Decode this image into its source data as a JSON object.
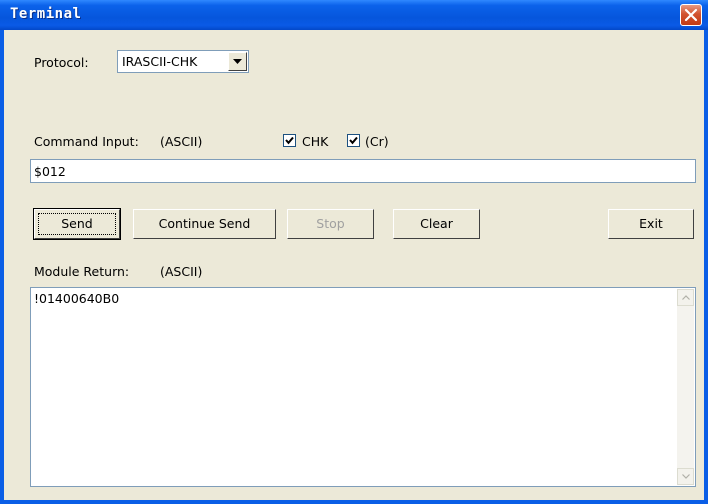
{
  "window": {
    "title": "Terminal"
  },
  "protocol": {
    "label": "Protocol:",
    "value": "IRASCII-CHK"
  },
  "command": {
    "label": "Command Input:",
    "mode": "(ASCII)",
    "chk_label": "CHK",
    "chk_checked": true,
    "cr_label": "(Cr)",
    "cr_checked": true,
    "value": "$012"
  },
  "buttons": {
    "send": "Send",
    "continue_send": "Continue Send",
    "stop": "Stop",
    "clear": "Clear",
    "exit": "Exit"
  },
  "module_return": {
    "label": "Module Return:",
    "mode": "(ASCII)",
    "value": "!01400640B0"
  }
}
